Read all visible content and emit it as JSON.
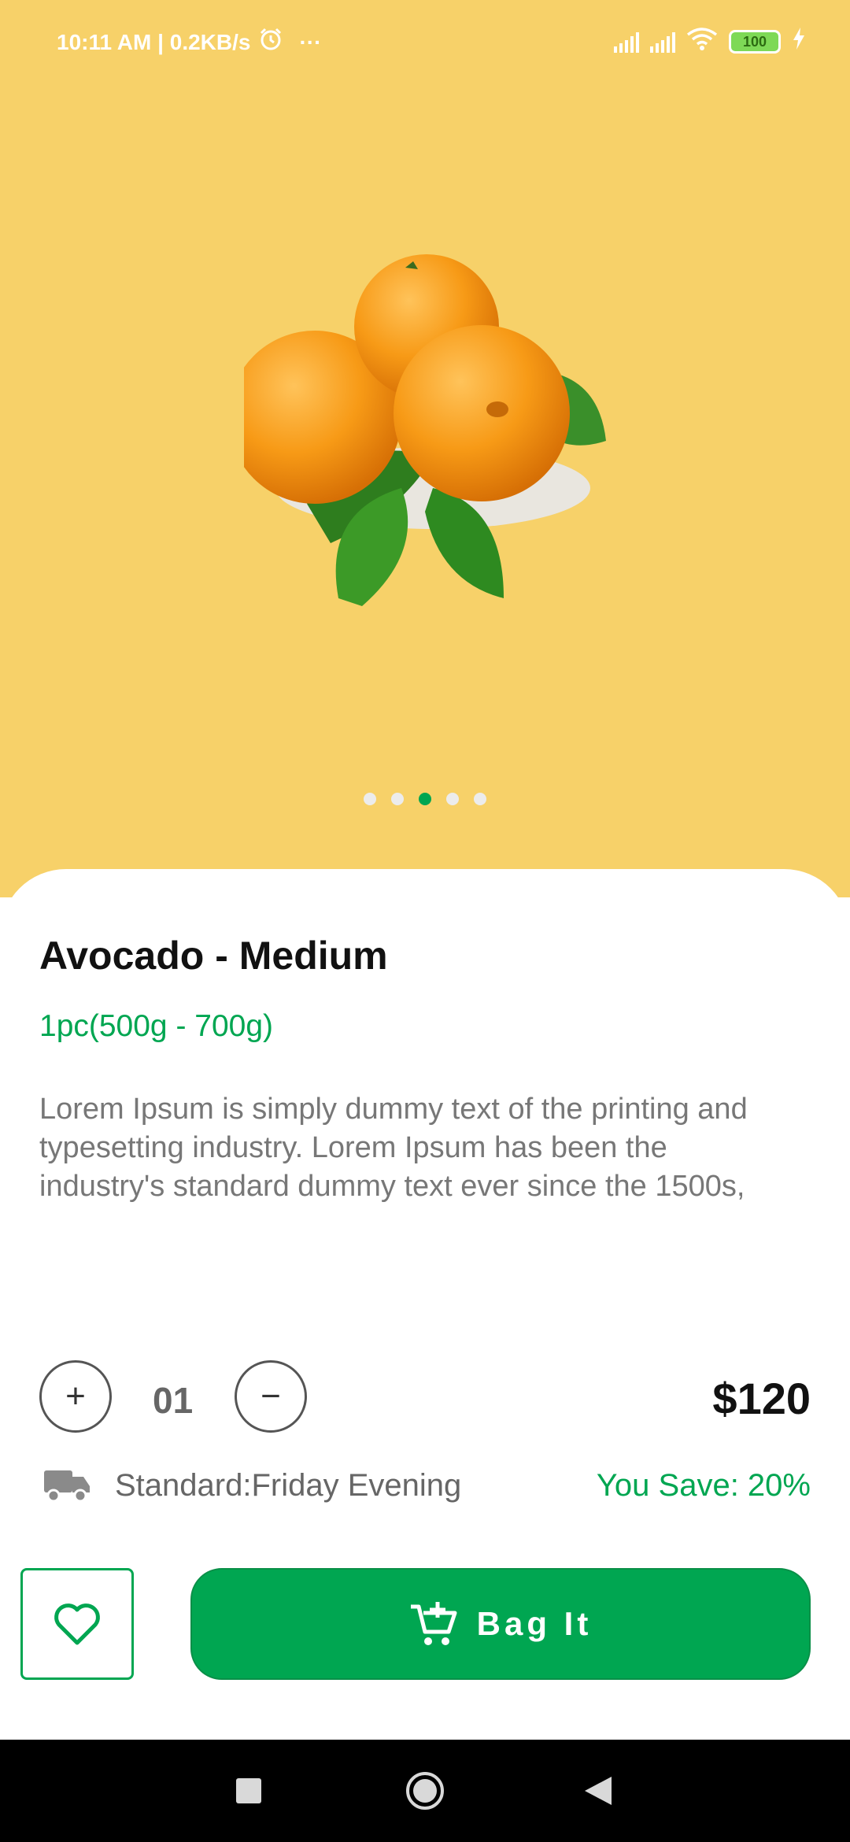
{
  "status_bar": {
    "time_info": "10:11 AM | 0.2KB/s",
    "more": "···",
    "battery": "100"
  },
  "product": {
    "title": "Avocado - Medium",
    "quantity_spec": "1pc(500g - 700g)",
    "description": "Lorem Ipsum is simply dummy text of the printing and typesetting industry. Lorem Ipsum has been the industry's standard dummy text ever since the 1500s,",
    "price": "$120",
    "delivery": "Standard:Friday Evening",
    "savings": "You Save: 20%"
  },
  "carousel": {
    "total": 5,
    "active_index": 2
  },
  "quantity": {
    "plus": "+",
    "value": "01",
    "minus": "−"
  },
  "actions": {
    "bag_label": "Bag It"
  },
  "colors": {
    "hero_bg": "#F7D169",
    "accent": "#00A651",
    "card_bg": "#FFFFFF"
  },
  "icons": [
    "alarm-icon",
    "cell-signal-icon",
    "wifi-icon",
    "battery-icon",
    "charging-icon",
    "truck-icon",
    "heart-icon",
    "cart-add-icon",
    "recents-icon",
    "home-icon",
    "back-icon"
  ]
}
